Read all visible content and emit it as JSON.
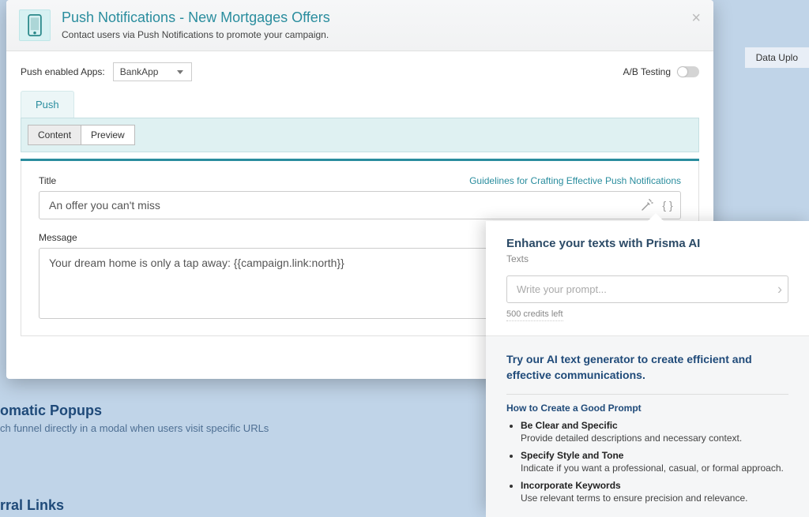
{
  "background": {
    "data_upload": "Data Uplo",
    "popups_title": "omatic Popups",
    "popups_desc": "ch funnel directly in a modal when users visit specific URLs",
    "links_title": "rral Links"
  },
  "modal": {
    "title": "Push Notifications - New Mortgages Offers",
    "subtitle": "Contact users via Push Notifications to promote your campaign.",
    "apps_label": "Push enabled Apps:",
    "app_selected": "BankApp",
    "ab_label": "A/B Testing",
    "tab_push": "Push",
    "subtab_content": "Content",
    "subtab_preview": "Preview",
    "title_label": "Title",
    "guidelines": "Guidelines for Crafting Effective Push Notifications",
    "title_value": "An offer you can't miss",
    "message_label": "Message",
    "message_value": "Your dream home is only a tap away: {{campaign.link:north}}"
  },
  "ai": {
    "heading": "Enhance your texts with Prisma AI",
    "sub": "Texts",
    "placeholder": "Write your prompt...",
    "credits": "500 credits left",
    "try_line": "Try our AI text generator to create efficient and effective communications.",
    "howto": "How to Create a Good Prompt",
    "tips": [
      {
        "b": "Be Clear and Specific",
        "d": "Provide detailed descriptions and necessary context."
      },
      {
        "b": "Specify Style and Tone",
        "d": "Indicate if you want a professional, casual, or formal approach."
      },
      {
        "b": "Incorporate Keywords",
        "d": "Use relevant terms to ensure precision and relevance."
      }
    ]
  }
}
